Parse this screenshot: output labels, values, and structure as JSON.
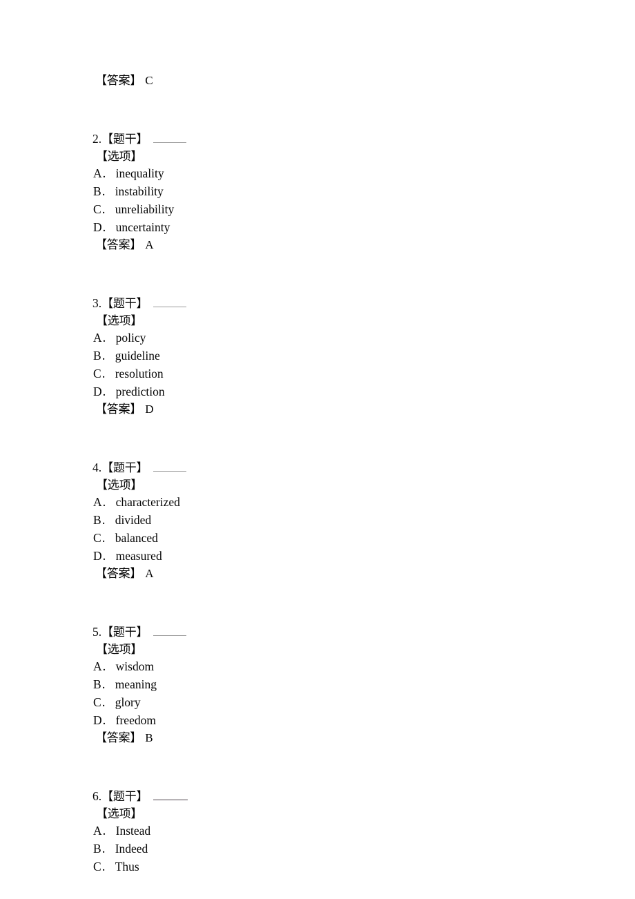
{
  "document": {
    "type": "exam-answer-key",
    "language": "zh-CN",
    "labels": {
      "stem": "【题干】",
      "options": "【选项】",
      "answer": "【答案】"
    },
    "blank_placeholder": "____"
  },
  "leading_answer": {
    "label": "【答案】",
    "value": "C"
  },
  "questions": [
    {
      "number": "2.",
      "stem_label": "【题干】",
      "options_label": "【选项】",
      "options": [
        {
          "letter": "A",
          "dot": "．",
          "text": "inequality"
        },
        {
          "letter": "B",
          "dot": "．",
          "text": "instability"
        },
        {
          "letter": "C",
          "dot": "．",
          "text": "unreliability"
        },
        {
          "letter": "D",
          "dot": "．",
          "text": "uncertainty"
        }
      ],
      "answer_label": "【答案】",
      "answer": "A"
    },
    {
      "number": "3.",
      "stem_label": "【题干】",
      "options_label": "【选项】",
      "options": [
        {
          "letter": "A",
          "dot": "．",
          "text": "policy"
        },
        {
          "letter": "B",
          "dot": "．",
          "text": "guideline"
        },
        {
          "letter": "C",
          "dot": "．",
          "text": "resolution"
        },
        {
          "letter": "D",
          "dot": "．",
          "text": "prediction"
        }
      ],
      "answer_label": "【答案】",
      "answer": "D"
    },
    {
      "number": "4.",
      "stem_label": "【题干】",
      "options_label": "【选项】",
      "options": [
        {
          "letter": "A",
          "dot": "．",
          "text": "characterized"
        },
        {
          "letter": "B",
          "dot": "．",
          "text": "divided"
        },
        {
          "letter": "C",
          "dot": "．",
          "text": "balanced"
        },
        {
          "letter": "D",
          "dot": "．",
          "text": "measured"
        }
      ],
      "answer_label": "【答案】",
      "answer": "A"
    },
    {
      "number": "5.",
      "stem_label": "【题干】",
      "options_label": "【选项】",
      "options": [
        {
          "letter": "A",
          "dot": "．",
          "text": "wisdom"
        },
        {
          "letter": "B",
          "dot": "．",
          "text": "meaning"
        },
        {
          "letter": "C",
          "dot": "．",
          "text": "glory"
        },
        {
          "letter": "D",
          "dot": "．",
          "text": "freedom"
        }
      ],
      "answer_label": "【答案】",
      "answer": "B"
    },
    {
      "number": "6.",
      "stem_label": "【题干】",
      "options_label": "【选项】",
      "options": [
        {
          "letter": "A",
          "dot": "．",
          "text": "Instead"
        },
        {
          "letter": "B",
          "dot": "．",
          "text": "Indeed"
        },
        {
          "letter": "C",
          "dot": "．",
          "text": "Thus"
        }
      ],
      "answer_label": "",
      "answer": ""
    }
  ]
}
